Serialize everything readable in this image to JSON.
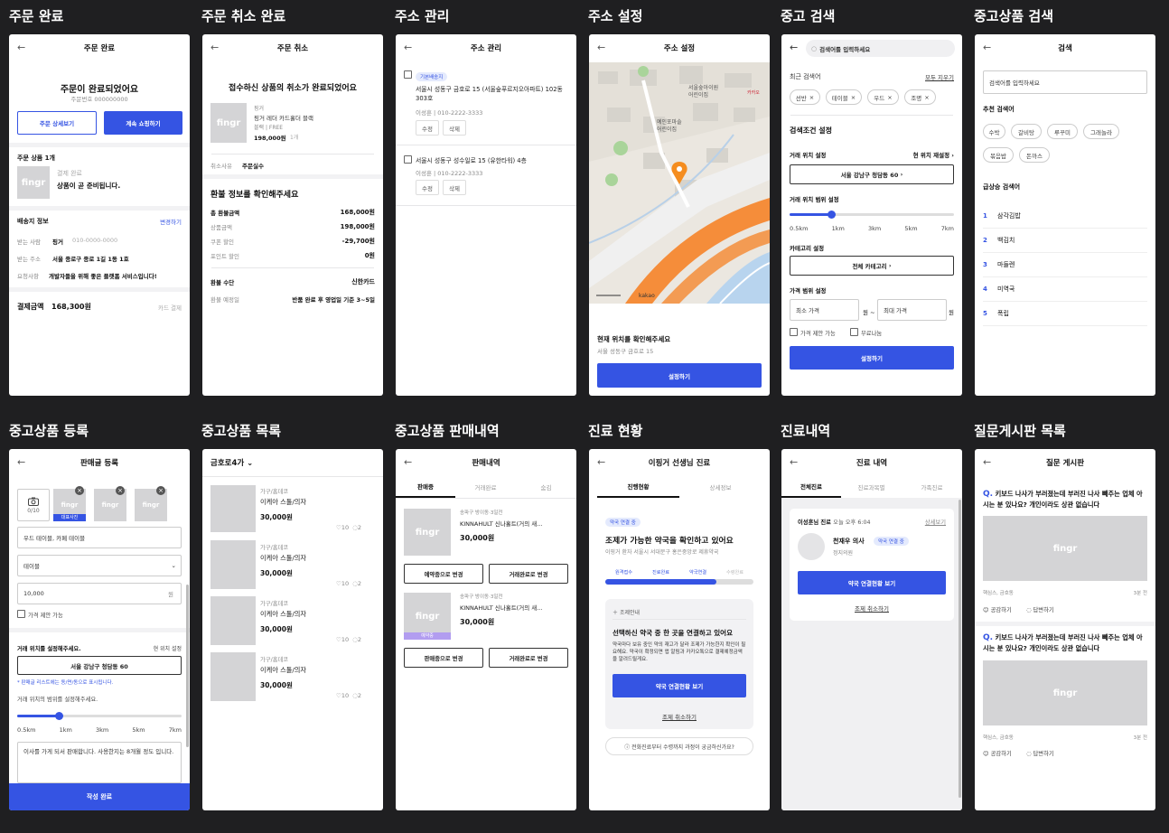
{
  "labels": [
    "주문 완료",
    "주문 취소 완료",
    "주소 관리",
    "주소 설정",
    "중고 검색",
    "중고상품 검색",
    "중고상품 등록",
    "중고상품 목록",
    "중고상품 판매내역",
    "진료 현황",
    "진료내역",
    "질문게시판 목록"
  ],
  "thumb_text": "fingr",
  "order": {
    "title": "주문 완료",
    "headline": "주문이 완료되었어요",
    "order_no": "주문번호 000000000",
    "detail_btn": "주문 상세보기",
    "continue_btn": "계속 쇼핑하기",
    "items_title": "주문 상품 1개",
    "pay_status": "결제 완료",
    "prep_status": "상품이 곧 준비됩니다.",
    "ship_title": "배송지 정보",
    "ship_edit": "변경하기",
    "rows": [
      {
        "k": "받는 사람",
        "v": "핑거",
        "extra": "010-0000-0000"
      },
      {
        "k": "받는 주소",
        "v": "서울 종로구 종로 1길 1동 1호",
        "extra": ""
      },
      {
        "k": "요청사항",
        "v": "개발자들을 위해 좋은 플랫폼 서비스입니다!",
        "extra": ""
      }
    ],
    "pay_label": "결제금액",
    "pay_amount": "168,300원",
    "pay_method": "카드 결제"
  },
  "cancel": {
    "title": "주문 취소",
    "headline": "접수하신 상품의 취소가 완료되었어요",
    "brand": "핑거",
    "name": "핑거 레더 카드홀더 블랙",
    "option": "블랙 | FREE",
    "price": "198,000원",
    "qty": "1개",
    "reason_label": "취소사유",
    "reason": "주문실수",
    "refund_title": "환불 정보를 확인해주세요",
    "rows": [
      {
        "k": "총 환불금액",
        "v": "168,000원",
        "bold": true
      },
      {
        "k": "상품금액",
        "v": "198,000원",
        "bold": false
      },
      {
        "k": "쿠폰 할인",
        "v": "-29,700원",
        "bold": false
      },
      {
        "k": "포인트 할인",
        "v": "0원",
        "bold": false
      }
    ],
    "method_label": "환불 수단",
    "method": "신한카드",
    "date_label": "환불 예정일",
    "date": "반품 완료 후 영업일 기준 3~5일"
  },
  "addr": {
    "title": "주소 관리",
    "default_badge": "기본배송지",
    "items": [
      {
        "addr": "서울시 성동구 금호로 15 (서울숲푸르지오아파트) 102동 303호",
        "person": "이성훈 | 010-2222-3333"
      },
      {
        "addr": "서울시 성동구 성수일로 15 (유한타워) 4층",
        "person": "이성훈 | 010-2222-3333"
      }
    ],
    "edit": "수정",
    "delete": "삭제"
  },
  "addrset": {
    "title": "주소 설정",
    "map_texts": [
      "서울숲아이원",
      "어린이집",
      "예인포마솔",
      "어린이집",
      "카카오",
      "kakao"
    ],
    "confirm": "현재 위치를 확인해주세요",
    "addr": "서울 성동구 금호로 15",
    "btn": "설정하기"
  },
  "usedsearch": {
    "placeholder": "검색어를 입력하세요",
    "recent": "최근 검색어",
    "clear": "모두 지우기",
    "chips": [
      "선반",
      "테이블",
      "우드",
      "조명"
    ],
    "cond": "검색조건 설정",
    "loc": "거래 위치 설정",
    "loc_reset": "현 위치 재설정",
    "loc_btn": "서울 강남구 청담동 60",
    "range": "거래 위치 범위 설정",
    "ticks": [
      "0.5km",
      "1km",
      "3km",
      "5km",
      "7km"
    ],
    "range_value": 0.25,
    "cat": "카테고리 설정",
    "cat_btn": "전체 카테고리",
    "price": "가격 범위 설정",
    "min": "최소 가격",
    "max": "최대 가격",
    "won": "원",
    "tilde": "~",
    "nego": "가격 제안 가능",
    "free": "무료나눔",
    "btn": "설정하기"
  },
  "prodsearch": {
    "title": "검색",
    "placeholder": "검색어를 입력하세요",
    "rec": "추천 검색어",
    "chips": [
      "수박",
      "갈비탕",
      "루꾸미",
      "그래놀라",
      "볶음밥",
      "돈까스"
    ],
    "rising": "급상승 검색어",
    "ranks": [
      {
        "n": "1",
        "t": "삼각김밥"
      },
      {
        "n": "2",
        "t": "백김치"
      },
      {
        "n": "3",
        "t": "마들렌"
      },
      {
        "n": "4",
        "t": "미역국"
      },
      {
        "n": "5",
        "t": "폭립"
      }
    ]
  },
  "reg": {
    "title": "판매글 등록",
    "count": "0/10",
    "rep": "대표사진",
    "name": "우드 테이블, 카페 테이블",
    "cat": "테이블",
    "price": "10,000",
    "won": "원",
    "nego": "가격 제안 가능",
    "loc": "거래 위치를 설정해주세요.",
    "loc_reset": "현 위치 설정",
    "loc_btn": "서울 강남구 청담동 60",
    "note": "* 판매글 리스트에는 동/면/동으로 표시됩니다.",
    "range": "거래 위치의 범위를 설정해주세요.",
    "ticks": [
      "0.5km",
      "1km",
      "3km",
      "5km",
      "7km"
    ],
    "range_value": 0.25,
    "desc": "이사를 가게 되서 판매합니다. 사용한지는 8개월 정도 입니다.",
    "btn": "작성 완료"
  },
  "list": {
    "location": "금호로4가",
    "items": [
      {
        "cat": "가구/홈데코",
        "name": "이케아 스툴/의자",
        "price": "30,000원",
        "likes": "10",
        "comments": "2"
      },
      {
        "cat": "가구/홈데코",
        "name": "이케아 스툴/의자",
        "price": "30,000원",
        "likes": "10",
        "comments": "2"
      },
      {
        "cat": "가구/홈데코",
        "name": "이케아 스툴/의자",
        "price": "30,000원",
        "likes": "10",
        "comments": "2"
      },
      {
        "cat": "가구/홈데코",
        "name": "이케아 스툴/의자",
        "price": "30,000원",
        "likes": "10",
        "comments": "2"
      }
    ]
  },
  "sales": {
    "title": "판매내역",
    "tabs": [
      "판매중",
      "거래완료",
      "숨김"
    ],
    "items": [
      {
        "loc": "송파구 방이동·3일전",
        "name": "KINNAHULT 신나홀트(거의 새...",
        "price": "30,000원",
        "b1": "예약중으로 변경",
        "b2": "거래완료로 변경",
        "tag": ""
      },
      {
        "loc": "송파구 방이동·3일전",
        "name": "KINNAHULT 신나홀트(거의 새...",
        "price": "30,000원",
        "b1": "판매중으로 변경",
        "b2": "거래완료로 변경",
        "tag": "예약중"
      }
    ]
  },
  "care": {
    "title": "이핑거 선생님 진료",
    "tabs": [
      "진행현황",
      "상세정보"
    ],
    "badge": "약국 연결 중",
    "headline": "조제가 가능한 약국을 확인하고 있어요",
    "sub": "이핑거 환자 서울시 서대문구 홍은중앙로 제휴약국",
    "steps": [
      "원격접수",
      "진료완료",
      "약국연결",
      "수령완료"
    ],
    "progress": 0.75,
    "notice": "조제안내",
    "box_title": "선택하신 약국 중 한 곳을 연결하고 있어요",
    "box_desc": "약국마다 보유 중인 약의 재고가 달라 조제가 가능한지 확인이 필요해요. 약국이 확정되면 앱 알림과 카카오톡으로 결제예정금액을 알려드릴게요.",
    "btn": "약국 연결현황 보기",
    "cancel": "조제 취소하기",
    "faq": "전화진료부터 수령까지 과정이 궁금하신가요?"
  },
  "history": {
    "title": "진료 내역",
    "tabs": [
      "전체진료",
      "진료과목별",
      "가족진료"
    ],
    "visit": "이성훈님 진료",
    "date": "오늘 오후 6:04",
    "detail": "상세보기",
    "doctor": "천재우 의사",
    "badge": "약국 연결 중",
    "dept": "정지의원",
    "btn": "약국 연결현황 보기",
    "cancel": "조제 취소하기"
  },
  "qna": {
    "title": "질문 게시판",
    "q": "Q.",
    "posts": [
      {
        "text": "키보드 나사가 부러졌는데 부러진 나사 빼주는 업체 아시는 분 있나요? 개인이라도 상관 없습니다",
        "meta": "핵심스, 금호동",
        "time": "3분 전"
      },
      {
        "text": "키보드 나사가 부러졌는데 부러진 나사 빼주는 업체 아시는 분 있나요? 개인이라도 상관 없습니다",
        "meta": "핵심스, 금호동",
        "time": "3분 전"
      }
    ],
    "like": "공감하기",
    "reply": "답변하기"
  }
}
